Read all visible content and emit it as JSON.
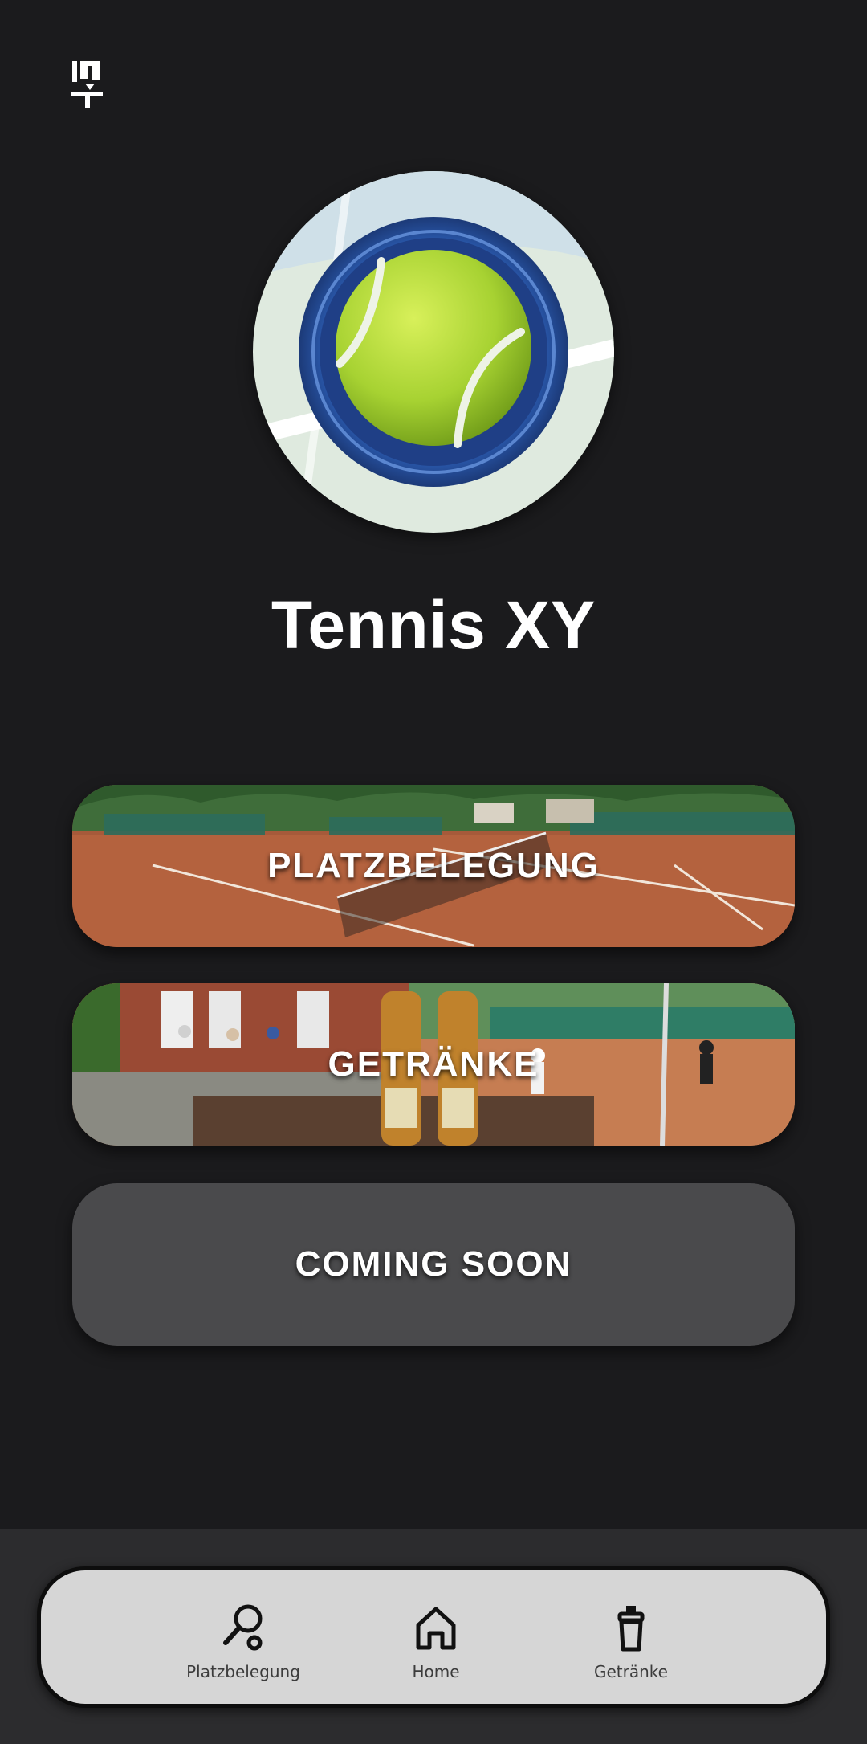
{
  "club": {
    "name": "Tennis XY"
  },
  "tiles": [
    {
      "label": "PLATZBELEGUNG"
    },
    {
      "label": "GETRÄNKE"
    },
    {
      "label": "COMING SOON"
    }
  ],
  "bottom_nav": {
    "items": [
      {
        "label": "Platzbelegung",
        "icon": "tennis-racket-icon"
      },
      {
        "label": "Home",
        "icon": "home-icon"
      },
      {
        "label": "Getränke",
        "icon": "drink-bottle-icon"
      }
    ]
  },
  "colors": {
    "background": "#1b1b1d",
    "nav_background": "#d6d6d6",
    "tile_placeholder": "#4a4a4c",
    "ball": "#b6dc3c",
    "logo_ring": "#2a4f9c"
  }
}
